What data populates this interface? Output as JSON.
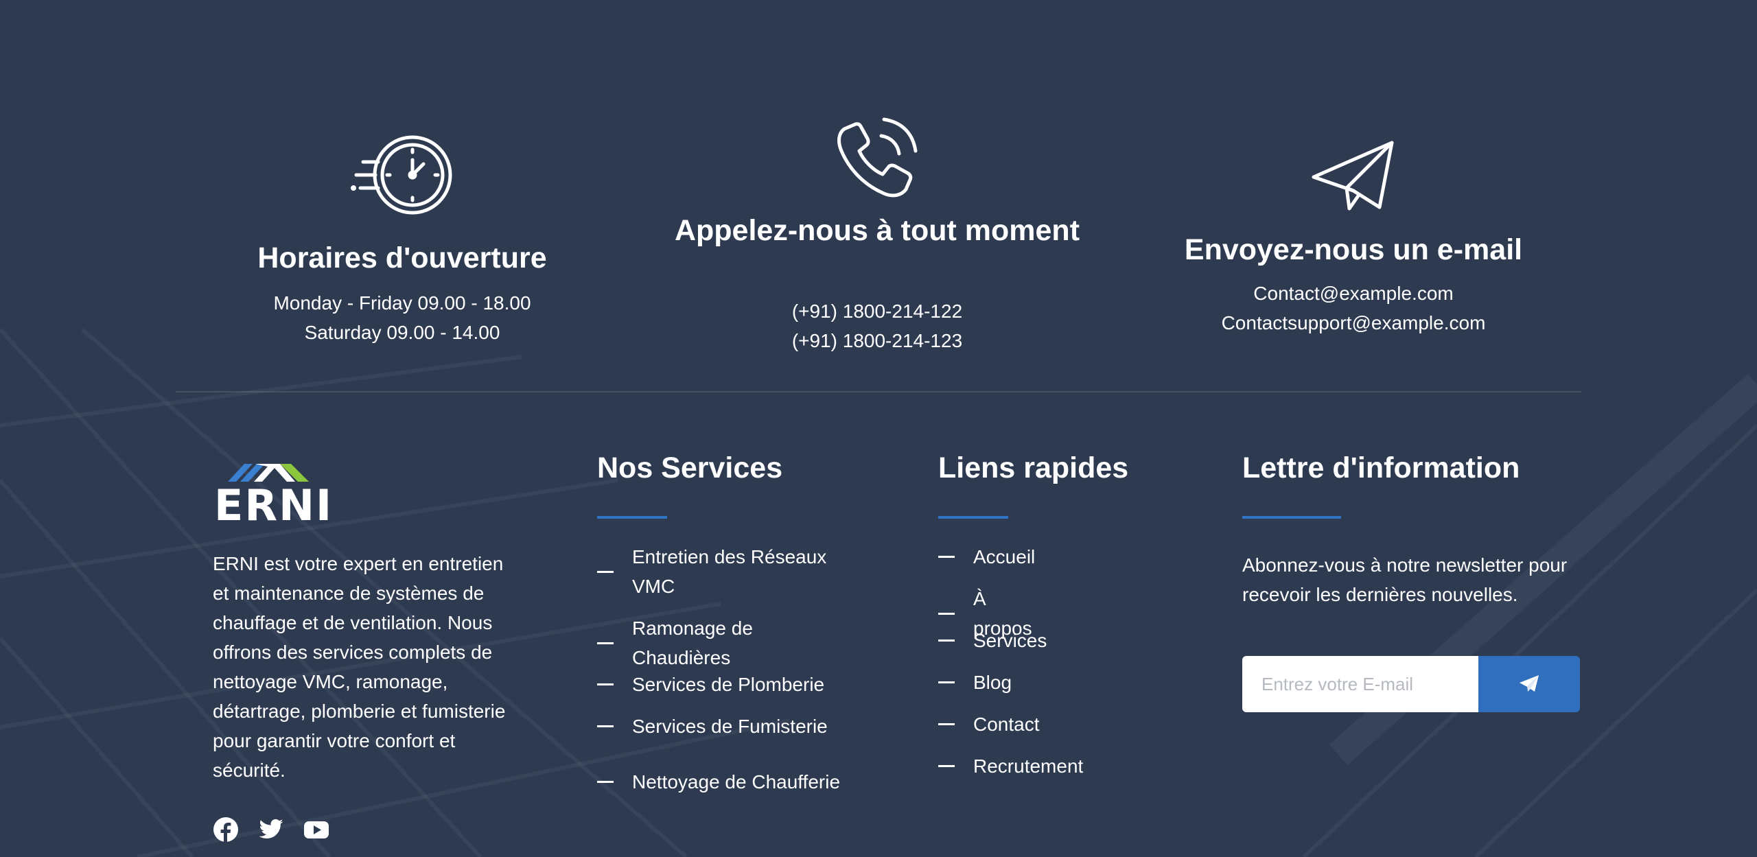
{
  "contact_cards": [
    {
      "icon": "clock-icon",
      "title": "Horaires d'ouverture",
      "lines": [
        "Monday - Friday 09.00 - 18.00",
        "Saturday 09.00 - 14.00"
      ]
    },
    {
      "icon": "phone-icon",
      "title": "Appelez-nous à tout moment",
      "lines": [
        "(+91) 1800-214-122",
        "(+91) 1800-214-123"
      ]
    },
    {
      "icon": "paper-plane-icon",
      "title": "Envoyez-nous un e-mail",
      "lines": [
        "Contact@example.com",
        "Contactsupport@example.com"
      ]
    }
  ],
  "brand": {
    "logo_text": "ERNI",
    "about": "ERNI est votre expert en entretien et maintenance de systèmes de chauffage et de ventilation. Nous offrons des services complets de nettoyage VMC, ramonage, détartrage, plomberie et fumisterie pour garantir votre confort et sécurité.",
    "socials": [
      "facebook-icon",
      "twitter-icon",
      "youtube-icon"
    ]
  },
  "services": {
    "title": "Nos Services",
    "items": [
      "Entretien des Réseaux VMC",
      "Ramonage de Chaudières",
      "Services de Plomberie",
      "Services de Fumisterie",
      "Nettoyage de Chaufferie"
    ]
  },
  "links": {
    "title": "Liens rapides",
    "items": [
      "Accueil",
      "À propos",
      "Services",
      "Blog",
      "Contact",
      "Recrutement"
    ]
  },
  "newsletter": {
    "title": "Lettre d'information",
    "text": "Abonnez-vous à notre newsletter pour recevoir les dernières nouvelles.",
    "placeholder": "Entrez votre E-mail"
  },
  "colors": {
    "background": "#2e3a50",
    "accent": "#2f6fbd",
    "logo_blue": "#3a7fd0",
    "logo_green": "#8cc63f"
  }
}
